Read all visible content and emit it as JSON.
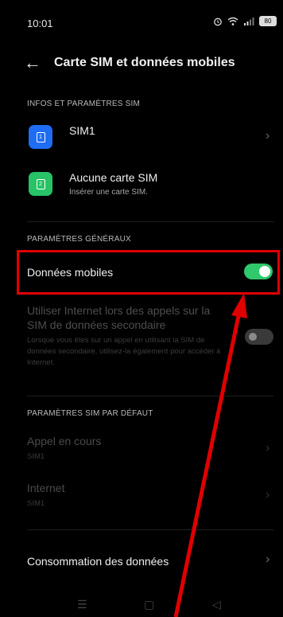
{
  "status_bar": {
    "time": "10:01",
    "battery": "80"
  },
  "header": {
    "title": "Carte SIM et données mobiles"
  },
  "sections": {
    "sim_info": "INFOS ET PARAMÈTRES SIM",
    "general": "PARAMÈTRES GÉNÉRAUX",
    "default_sim": "PARAMÈTRES SIM PAR DÉFAUT"
  },
  "sims": [
    {
      "label": "SIM1",
      "number": "1",
      "color": "#1e6df2"
    },
    {
      "label": "Aucune carte SIM",
      "sub": "Insérer une carte SIM.",
      "number": "2",
      "color": "#28c267"
    }
  ],
  "mobile_data": {
    "label": "Données mobiles",
    "enabled": true,
    "toggle_color": "#2fc86b"
  },
  "secondary": {
    "title": "Utiliser Internet lors des appels sur la SIM de données secondaire",
    "desc": "Lorsque vous êtes sur un appel en utilisant la SIM de données secondaire, utilisez-la également pour accéder à Internet.",
    "enabled": false
  },
  "defaults": [
    {
      "label": "Appel en cours",
      "value": "SIM1"
    },
    {
      "label": "Internet",
      "value": "SIM1"
    }
  ],
  "consumption": {
    "label": "Consommation des données"
  },
  "highlight_color": "#e00000"
}
